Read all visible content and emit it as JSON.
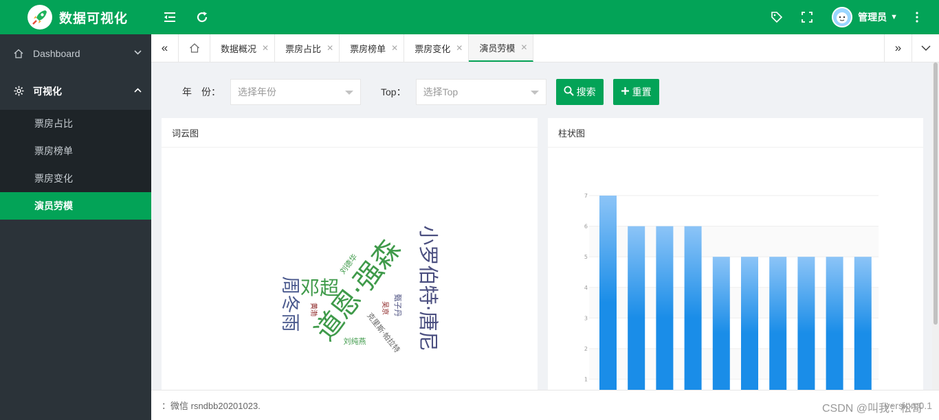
{
  "header": {
    "title": "数据可视化",
    "user_name": "管理员"
  },
  "sidebar": {
    "items": [
      {
        "label": "Dashboard"
      },
      {
        "label": "可视化"
      }
    ],
    "sub_items": [
      {
        "label": "票房占比"
      },
      {
        "label": "票房榜单"
      },
      {
        "label": "票房变化"
      },
      {
        "label": "演员劳模"
      }
    ]
  },
  "tabs": [
    {
      "label": "数据概况"
    },
    {
      "label": "票房占比"
    },
    {
      "label": "票房榜单"
    },
    {
      "label": "票房变化"
    },
    {
      "label": "演员劳模"
    }
  ],
  "search": {
    "year_label": "年　份：",
    "year_placeholder": "选择年份",
    "top_label": "Top：",
    "top_placeholder": "选择Top",
    "search_button": "搜索",
    "reset_button": "重置"
  },
  "cards": {
    "wordcloud_title": "词云图",
    "bar_title": "柱状图"
  },
  "wordcloud": [
    {
      "text": "道恩·强森",
      "color": "#3f9a4a"
    },
    {
      "text": "小罗伯特·唐尼",
      "color": "#4b4f80"
    },
    {
      "text": "周冬雨",
      "color": "#4b5a8e"
    },
    {
      "text": "邓超",
      "color": "#3f9a4a"
    },
    {
      "text": "刘德华",
      "color": "#3f9a4a"
    },
    {
      "text": "甄子丹",
      "color": "#4b4f80"
    },
    {
      "text": "刘纯燕",
      "color": "#3f9a4a"
    },
    {
      "text": "克里斯·帕拉特",
      "color": "#666666"
    },
    {
      "text": "吴京",
      "color": "#8a2020"
    },
    {
      "text": "黄渤",
      "color": "#8a2020"
    }
  ],
  "chart_data": {
    "type": "bar",
    "values": [
      7,
      6,
      6,
      6,
      5,
      5,
      5,
      5,
      5,
      5
    ],
    "ylim": [
      0,
      7
    ],
    "yticks": [
      "1",
      "2",
      "3",
      "4",
      "5",
      "6",
      "7"
    ]
  },
  "footer": {
    "text": "：微信 rsndbb20201023.",
    "version": "version:0.1"
  },
  "watermark": "CSDN @叫我：松哥",
  "colors": {
    "brand": "#03a357",
    "sidebar": "#2b3339",
    "bar_top": "#8cc4f7",
    "bar_bottom": "#1a8de8"
  }
}
